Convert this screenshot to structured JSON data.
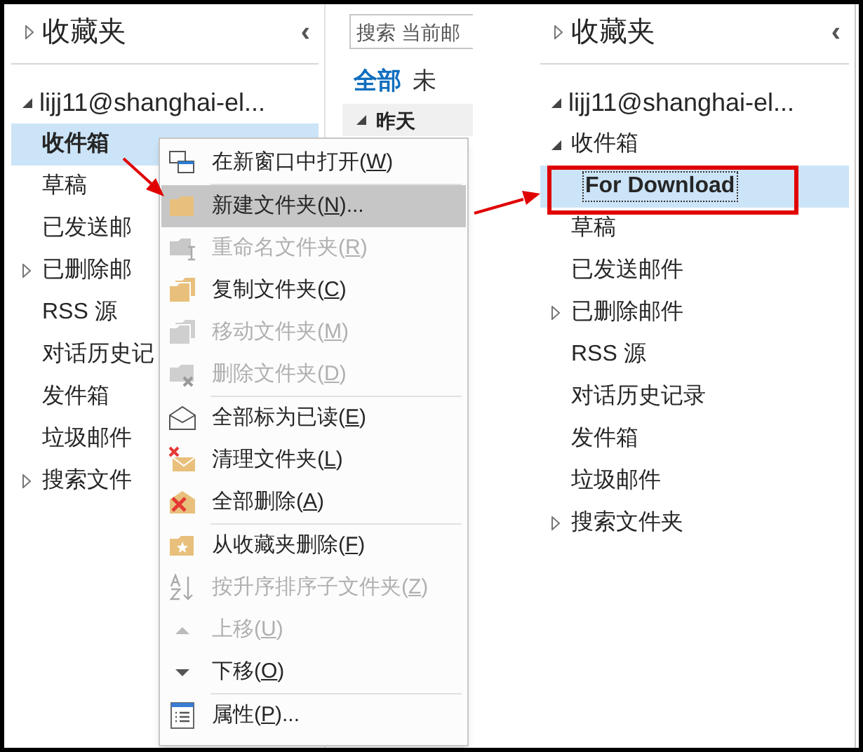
{
  "left_pane": {
    "favorites": {
      "label": "收藏夹",
      "expanded": false
    },
    "collapse_button": "‹",
    "account": {
      "label": "lijj11@shanghai-el...",
      "expanded": true
    },
    "folders": [
      {
        "label": "收件箱",
        "selected": true,
        "kind": "folder"
      },
      {
        "label": "草稿",
        "selected": false,
        "kind": "folder"
      },
      {
        "label": "已发送邮",
        "selected": false,
        "kind": "folder"
      },
      {
        "label": "已删除邮",
        "selected": false,
        "kind": "parent",
        "expanded": false
      },
      {
        "label": "RSS 源",
        "selected": false,
        "kind": "folder"
      },
      {
        "label": "对话历史记",
        "selected": false,
        "kind": "folder"
      },
      {
        "label": "发件箱",
        "selected": false,
        "kind": "folder"
      },
      {
        "label": "垃圾邮件",
        "selected": false,
        "kind": "folder"
      },
      {
        "label": "搜索文件",
        "selected": false,
        "kind": "parent",
        "expanded": false
      }
    ]
  },
  "message_list": {
    "search": {
      "placeholder": "搜索 当前邮"
    },
    "filters": [
      {
        "label": "全部",
        "selected": true
      },
      {
        "label": "未",
        "selected": false
      }
    ],
    "group_header": {
      "label": "昨天",
      "expanded": true
    }
  },
  "context_menu": [
    {
      "kind": "window",
      "before": "在新窗口中打开(",
      "key": "W",
      "after": ")",
      "disabled": false,
      "selected": false,
      "separator_after": true
    },
    {
      "kind": "folder",
      "before": "新建文件夹(",
      "key": "N",
      "after": ")...",
      "disabled": false,
      "selected": true,
      "separator_after": false
    },
    {
      "kind": "rename",
      "before": "重命名文件夹(",
      "key": "R",
      "after": ")",
      "disabled": true,
      "selected": false,
      "separator_after": false
    },
    {
      "kind": "copy",
      "before": "复制文件夹(",
      "key": "C",
      "after": ")",
      "disabled": false,
      "selected": false,
      "separator_after": false
    },
    {
      "kind": "move",
      "before": "移动文件夹(",
      "key": "M",
      "after": ")",
      "disabled": true,
      "selected": false,
      "separator_after": false
    },
    {
      "kind": "delete-folder",
      "before": "删除文件夹(",
      "key": "D",
      "after": ")",
      "disabled": true,
      "selected": false,
      "separator_after": true
    },
    {
      "kind": "envelope",
      "before": "全部标为已读(",
      "key": "E",
      "after": ")",
      "disabled": false,
      "selected": false,
      "separator_after": false
    },
    {
      "kind": "cleanup",
      "before": "清理文件夹(",
      "key": "L",
      "after": ")",
      "disabled": false,
      "selected": false,
      "separator_after": false
    },
    {
      "kind": "delete-all",
      "before": "全部删除(",
      "key": "A",
      "after": ")",
      "disabled": false,
      "selected": false,
      "separator_after": true
    },
    {
      "kind": "star-folder",
      "before": "从收藏夹删除(",
      "key": "F",
      "after": ")",
      "disabled": false,
      "selected": false,
      "separator_after": false
    },
    {
      "kind": "sort",
      "before": "按升序排序子文件夹(",
      "key": "Z",
      "after": ")",
      "disabled": true,
      "selected": false,
      "separator_after": false
    },
    {
      "kind": "up",
      "before": "上移(",
      "key": "U",
      "after": ")",
      "disabled": true,
      "selected": false,
      "separator_after": false
    },
    {
      "kind": "down",
      "before": "下移(",
      "key": "O",
      "after": ")",
      "disabled": false,
      "selected": false,
      "separator_after": true
    },
    {
      "kind": "properties",
      "before": "属性(",
      "key": "P",
      "after": ")...",
      "disabled": false,
      "selected": false,
      "separator_after": false
    }
  ],
  "right_pane": {
    "favorites": {
      "label": "收藏夹",
      "expanded": false
    },
    "collapse_button": "‹",
    "account": {
      "label": "lijj11@shanghai-el...",
      "expanded": true
    },
    "folders": [
      {
        "label": "收件箱",
        "selected": false,
        "kind": "parent",
        "expanded": true,
        "children": [
          {
            "label": "For Download",
            "selected": true,
            "kind": "folder",
            "focused": true
          }
        ]
      },
      {
        "label": "草稿",
        "selected": false,
        "kind": "folder"
      },
      {
        "label": "已发送邮件",
        "selected": false,
        "kind": "folder"
      },
      {
        "label": "已删除邮件",
        "selected": false,
        "kind": "parent",
        "expanded": false
      },
      {
        "label": "RSS 源",
        "selected": false,
        "kind": "folder"
      },
      {
        "label": "对话历史记录",
        "selected": false,
        "kind": "folder"
      },
      {
        "label": "发件箱",
        "selected": false,
        "kind": "folder"
      },
      {
        "label": "垃圾邮件",
        "selected": false,
        "kind": "folder"
      },
      {
        "label": "搜索文件夹",
        "selected": false,
        "kind": "parent",
        "expanded": false
      }
    ]
  }
}
